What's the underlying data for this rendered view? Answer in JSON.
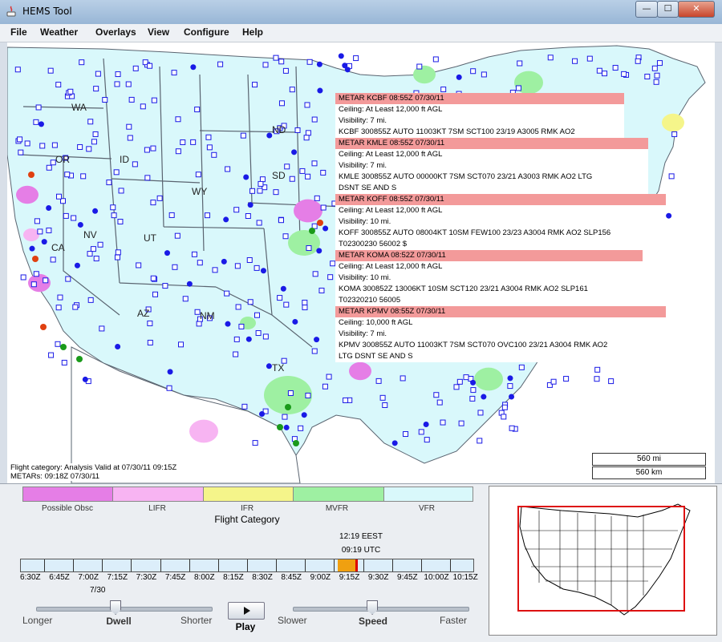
{
  "window": {
    "title": "HEMS Tool",
    "minimize_glyph": "—",
    "maximize_glyph": "☐",
    "close_glyph": "✕"
  },
  "menu": {
    "items": [
      "File",
      "Weather",
      "Overlays",
      "View",
      "Configure",
      "Help"
    ]
  },
  "map": {
    "state_labels": [
      "WA",
      "OR",
      "ID",
      "WY",
      "NV",
      "UT",
      "CA",
      "AZ",
      "NM",
      "ND",
      "SD",
      "TX"
    ],
    "colors": {
      "vfr_background": "#d9f8fb",
      "ocean": "#ffffff",
      "border": "#5a6470",
      "station": "#1a1ae6",
      "mvfr": "#9ef0a2",
      "ifr": "#f5f58a",
      "lifr": "#f7b4f2",
      "possible_obsc": "#e57ee6"
    }
  },
  "metars": [
    {
      "header": "METAR KCBF  08:55Z 07/30/11",
      "lines": [
        "Ceiling: At Least 12,000 ft AGL",
        "Visibility: 7 mi.",
        "KCBF 300855Z AUTO 11003KT 7SM SCT100 23/19 A3005 RMK AO2"
      ]
    },
    {
      "header": "METAR KMLE  08:55Z 07/30/11",
      "lines": [
        "Ceiling: At Least 12,000 ft AGL",
        "Visibility: 7 mi.",
        "KMLE 300855Z AUTO 00000KT 7SM SCT070 23/21 A3003 RMK AO2 LTG",
        "DSNT SE AND S"
      ]
    },
    {
      "header": "METAR KOFF  08:55Z 07/30/11",
      "lines": [
        "Ceiling: At Least 12,000 ft AGL",
        "Visibility: 10 mi.",
        "KOFF 300855Z AUTO 08004KT 10SM FEW100 23/23 A3004 RMK AO2 SLP156",
        "T02300230 56002 $"
      ]
    },
    {
      "header": "METAR KOMA  08:52Z 07/30/11",
      "lines": [
        "Ceiling: At Least 12,000 ft AGL",
        "Visibility: 10 mi.",
        "KOMA 300852Z 13006KT 10SM SCT120 23/21 A3004 RMK AO2 SLP161",
        "T02320210 56005"
      ]
    },
    {
      "header": "METAR KPMV  08:55Z 07/30/11",
      "lines": [
        "Ceiling: 10,000 ft AGL",
        "Visibility: 7 mi.",
        "KPMV 300855Z AUTO 11003KT 7SM SCT070 OVC100 23/21 A3004 RMK AO2",
        "LTG DSNT SE AND S"
      ]
    }
  ],
  "status": {
    "flight_category": "Flight category: Analysis Valid at 07/30/11 09:15Z",
    "metars": "METARs: 09:18Z 07/30/11"
  },
  "scale": {
    "miles": "560 mi",
    "km": "560 km"
  },
  "legend": {
    "title": "Flight Category",
    "categories": [
      {
        "label": "Possible Obsc",
        "color": "#e57ee6"
      },
      {
        "label": "LIFR",
        "color": "#f7b4f2"
      },
      {
        "label": "IFR",
        "color": "#f5f58a"
      },
      {
        "label": "MVFR",
        "color": "#9ef0a2"
      },
      {
        "label": "VFR",
        "color": "#d9f8fb"
      }
    ]
  },
  "time": {
    "local": "12:19 EEST",
    "utc": "09:19 UTC",
    "date": "7/30",
    "ticks": [
      "6:30Z",
      "6:45Z",
      "7:00Z",
      "7:15Z",
      "7:30Z",
      "7:45Z",
      "8:00Z",
      "8:15Z",
      "8:30Z",
      "8:45Z",
      "9:00Z",
      "9:15Z",
      "9:30Z",
      "9:45Z",
      "10:00Z",
      "10:15Z"
    ],
    "selected_tick": "9:15Z"
  },
  "controls": {
    "dwell_left": "Longer",
    "dwell_title": "Dwell",
    "dwell_right": "Shorter",
    "dwell_level": 0.45,
    "play": "Play",
    "speed_left": "Slower",
    "speed_title": "Speed",
    "speed_right": "Faster",
    "speed_level": 0.45
  }
}
